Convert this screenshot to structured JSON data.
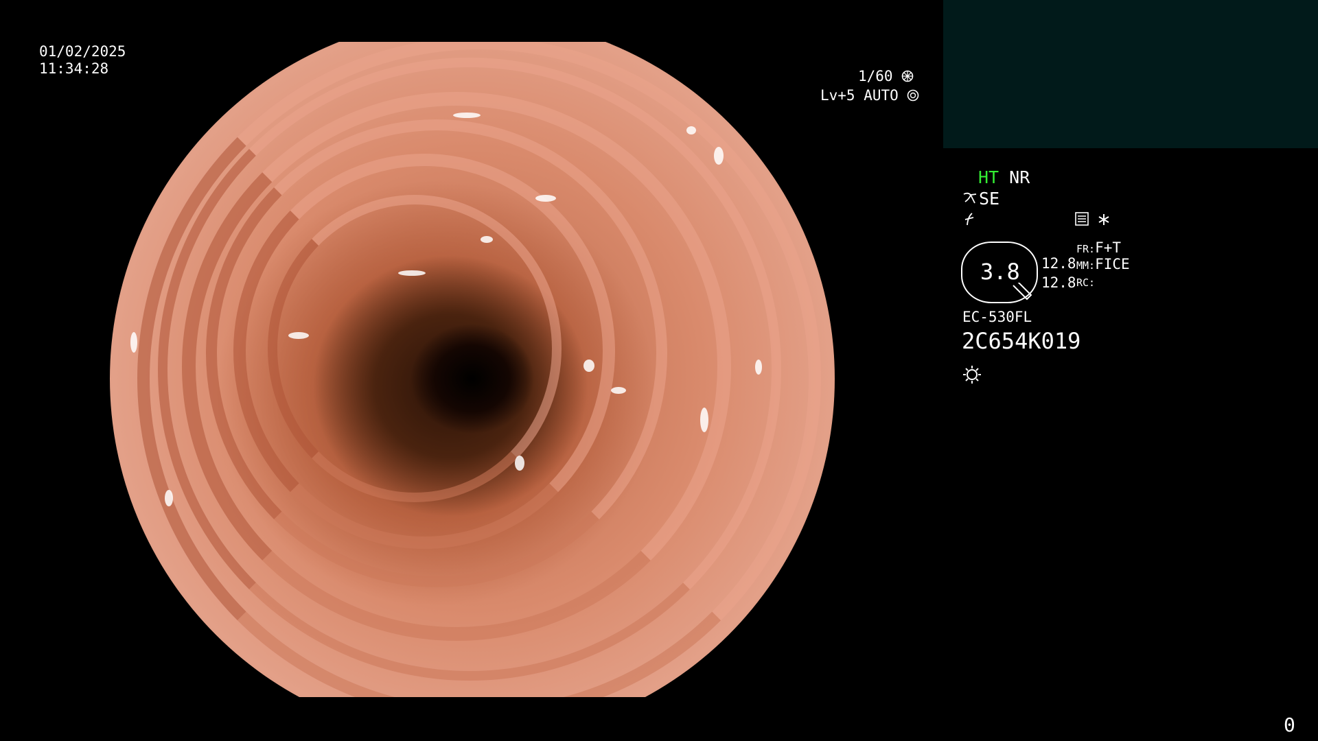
{
  "datetime": {
    "date": "01/02/2025",
    "time": "11:34:28"
  },
  "exposure": {
    "shutter": "1/60",
    "level": "Lv+5",
    "mode": "AUTO"
  },
  "modes": {
    "ht": "HT",
    "nr": "NR",
    "se": "SE"
  },
  "zoom": {
    "value": "3.8",
    "line1": "12.8",
    "line2": "12.8"
  },
  "settings": {
    "fr_label": "FR:",
    "fr_value": "F+T",
    "mm_label": "MM:",
    "mm_value": "FICE",
    "rc_label": "RC:"
  },
  "device": {
    "model": "EC-530FL",
    "serial": "2C654K019"
  },
  "corner_counter": "0",
  "icons": [
    "shutter-icon",
    "auto-iris-icon",
    "se-icon",
    "enhance-icon",
    "memory-icon",
    "asterisk-icon",
    "brightness-icon"
  ],
  "colors": {
    "ht_green": "#33ee33",
    "panel": "#011a1a"
  }
}
